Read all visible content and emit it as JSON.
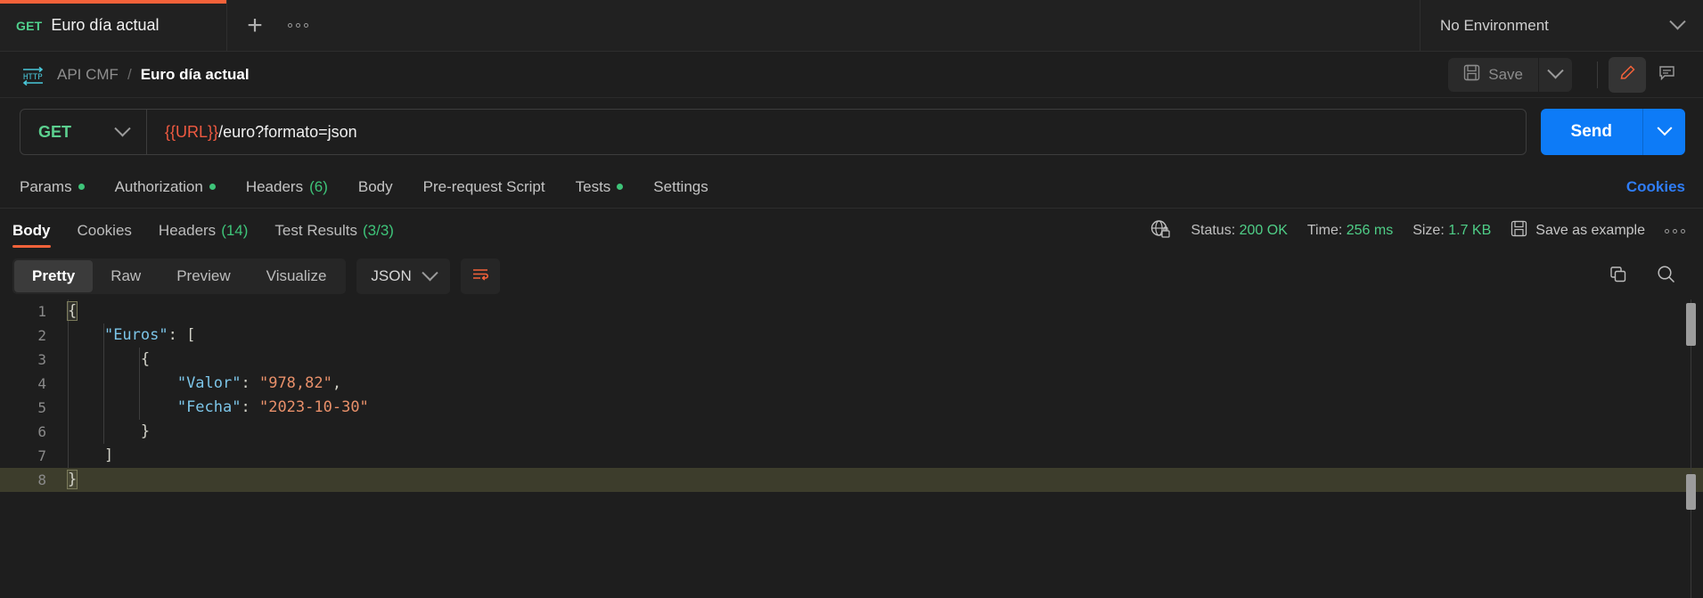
{
  "tabstrip": {
    "tabs": [
      {
        "method": "GET",
        "title": "Euro día actual",
        "active": true
      }
    ],
    "new_tab_label": "+",
    "more_label": "•••",
    "environment": {
      "selected": "No Environment",
      "icon": "chevron-down-icon"
    }
  },
  "breadcrumb": {
    "protocol_icon": "http-icon",
    "parent": "API CMF",
    "separator": "/",
    "current": "Euro día actual",
    "save_label": "Save",
    "save_icon": "floppy-disk-icon",
    "save_caret_icon": "chevron-down-icon",
    "edit_icon": "pencil-icon",
    "comment_icon": "comment-icon"
  },
  "request": {
    "method": "GET",
    "method_caret_icon": "chevron-down-icon",
    "url_variable": "{{URL}}",
    "url_path": "/euro?formato=json",
    "send_label": "Send",
    "send_caret_icon": "chevron-down-icon",
    "tabs": [
      {
        "label": "Params",
        "dot": true,
        "count": ""
      },
      {
        "label": "Authorization",
        "dot": true,
        "count": ""
      },
      {
        "label": "Headers",
        "dot": false,
        "count": "(6)"
      },
      {
        "label": "Body",
        "dot": false,
        "count": ""
      },
      {
        "label": "Pre-request Script",
        "dot": false,
        "count": ""
      },
      {
        "label": "Tests",
        "dot": true,
        "count": ""
      },
      {
        "label": "Settings",
        "dot": false,
        "count": ""
      }
    ],
    "cookies_link": "Cookies"
  },
  "response": {
    "tabs": [
      {
        "label": "Body",
        "count": "",
        "active": true
      },
      {
        "label": "Cookies",
        "count": "",
        "active": false
      },
      {
        "label": "Headers",
        "count": "(14)",
        "active": false
      },
      {
        "label": "Test Results",
        "count": "(3/3)",
        "active": false
      }
    ],
    "network_icon": "globe-lock-icon",
    "status_label": "Status:",
    "status_value": "200 OK",
    "time_label": "Time:",
    "time_value": "256 ms",
    "size_label": "Size:",
    "size_value": "1.7 KB",
    "save_example_label": "Save as example",
    "save_example_icon": "floppy-disk-icon",
    "more_icon": "ellipsis-icon",
    "view_modes": [
      {
        "label": "Pretty",
        "active": true
      },
      {
        "label": "Raw",
        "active": false
      },
      {
        "label": "Preview",
        "active": false
      },
      {
        "label": "Visualize",
        "active": false
      }
    ],
    "format": "JSON",
    "format_caret_icon": "chevron-down-icon",
    "wrap_icon": "word-wrap-icon",
    "copy_icon": "copy-icon",
    "search_icon": "search-icon",
    "body_lines": [
      {
        "n": "1",
        "segments": [
          {
            "t": "{",
            "c": "punc-box"
          }
        ]
      },
      {
        "n": "2",
        "segments": [
          {
            "t": "    ",
            "c": "plain"
          },
          {
            "t": "\"Euros\"",
            "c": "key"
          },
          {
            "t": ": [",
            "c": "punc"
          }
        ]
      },
      {
        "n": "3",
        "segments": [
          {
            "t": "        ",
            "c": "plain"
          },
          {
            "t": "{",
            "c": "punc"
          }
        ]
      },
      {
        "n": "4",
        "segments": [
          {
            "t": "            ",
            "c": "plain"
          },
          {
            "t": "\"Valor\"",
            "c": "key"
          },
          {
            "t": ": ",
            "c": "punc"
          },
          {
            "t": "\"978,82\"",
            "c": "str"
          },
          {
            "t": ",",
            "c": "punc"
          }
        ]
      },
      {
        "n": "5",
        "segments": [
          {
            "t": "            ",
            "c": "plain"
          },
          {
            "t": "\"Fecha\"",
            "c": "key"
          },
          {
            "t": ": ",
            "c": "punc"
          },
          {
            "t": "\"2023-10-30\"",
            "c": "str"
          }
        ]
      },
      {
        "n": "6",
        "segments": [
          {
            "t": "        ",
            "c": "plain"
          },
          {
            "t": "}",
            "c": "punc"
          }
        ]
      },
      {
        "n": "7",
        "segments": [
          {
            "t": "    ",
            "c": "plain"
          },
          {
            "t": "]",
            "c": "punc"
          }
        ]
      },
      {
        "n": "8",
        "segments": [
          {
            "t": "}",
            "c": "punc-box"
          }
        ],
        "active": true
      }
    ]
  },
  "colors": {
    "accent_orange": "#f4623a",
    "send_blue": "#0d7bf7",
    "success_green": "#4fce87",
    "method_green": "#5cd08f",
    "link_blue": "#2f7df6",
    "json_key": "#7cc5e8",
    "json_string": "#e8906a",
    "active_line": "#3d3d2c",
    "background": "#1e1e1e"
  }
}
